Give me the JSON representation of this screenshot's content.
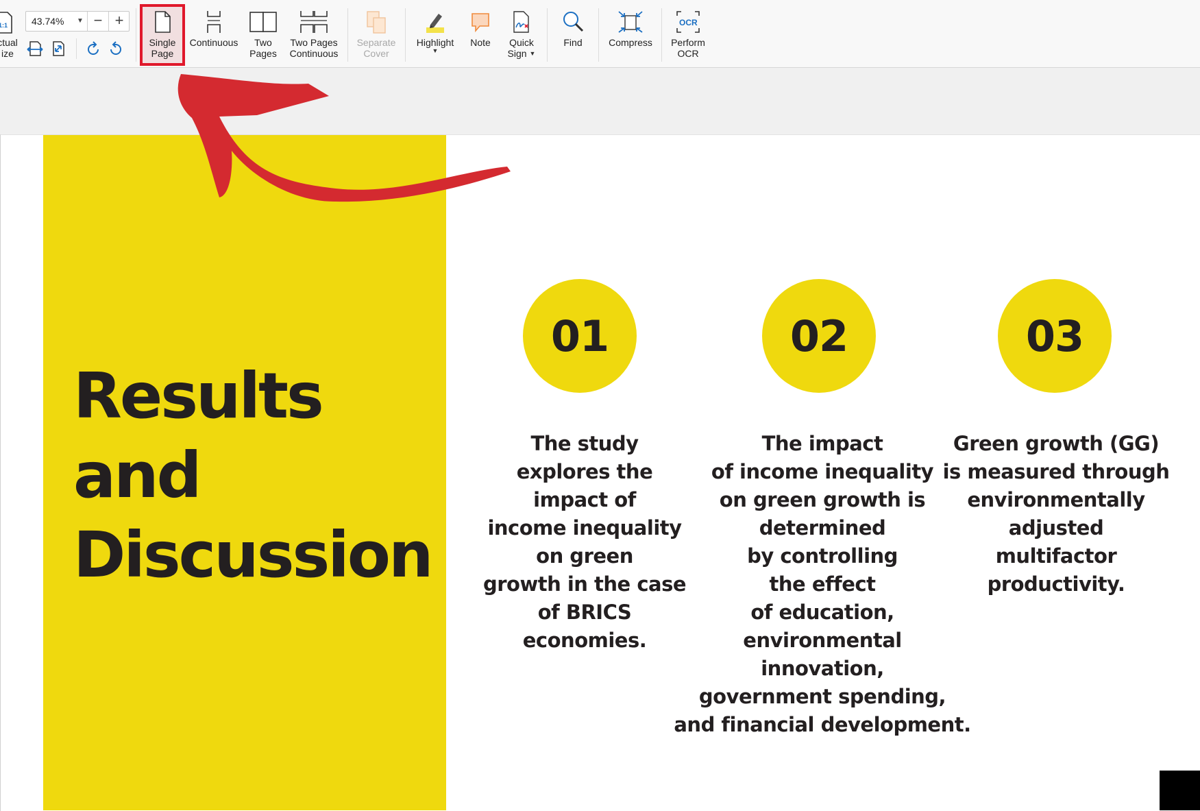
{
  "toolbar": {
    "actual_size": {
      "label_line1": "ctual",
      "label_line2": "ize",
      "icon": "actual-size-icon"
    },
    "zoom": {
      "value": "43.74%"
    },
    "buttons": [
      {
        "label_line1": "Single",
        "label_line2": "Page",
        "icon": "single-page-icon",
        "selected": true
      },
      {
        "label_line1": "Continuous",
        "label_line2": "",
        "icon": "continuous-icon"
      },
      {
        "label_line1": "Two",
        "label_line2": "Pages",
        "icon": "two-pages-icon"
      },
      {
        "label_line1": "Two Pages",
        "label_line2": "Continuous",
        "icon": "two-pages-continuous-icon"
      },
      {
        "label_line1": "Separate",
        "label_line2": "Cover",
        "icon": "separate-cover-icon",
        "disabled": true
      },
      {
        "label_line1": "Highlight",
        "label_line2": "",
        "icon": "highlight-icon",
        "dropdown": true
      },
      {
        "label_line1": "Note",
        "label_line2": "",
        "icon": "note-icon"
      },
      {
        "label_line1": "Quick",
        "label_line2": "Sign",
        "icon": "quick-sign-icon",
        "dropdown": true
      },
      {
        "label_line1": "Find",
        "label_line2": "",
        "icon": "find-icon"
      },
      {
        "label_line1": "Compress",
        "label_line2": "",
        "icon": "compress-icon"
      },
      {
        "label_line1": "Perform",
        "label_line2": "OCR",
        "icon": "ocr-icon",
        "icon_text": "OCR"
      }
    ],
    "icon_text_actual": "1:1"
  },
  "document": {
    "title_lines": [
      "Results",
      "and",
      "Discussion"
    ],
    "columns": [
      {
        "number": "01",
        "lines": [
          "The study",
          "explores the",
          "impact of",
          "income inequality",
          "on green",
          "growth in the case",
          "of BRICS",
          "economies."
        ]
      },
      {
        "number": "02",
        "lines": [
          "The impact",
          "of income inequality",
          "on green growth is",
          "determined",
          "by controlling",
          "the effect",
          "of education,",
          "environmental",
          "innovation,",
          "government spending,",
          "and financial development."
        ]
      },
      {
        "number": "03",
        "lines": [
          "Green growth (GG)",
          "is measured through",
          "environmentally",
          "adjusted",
          "multifactor",
          "productivity."
        ]
      }
    ]
  },
  "colors": {
    "accent_yellow": "#efd90e",
    "text_dark": "#231f20",
    "annotation_red": "#d42a30",
    "selection_red": "#e0182b"
  }
}
